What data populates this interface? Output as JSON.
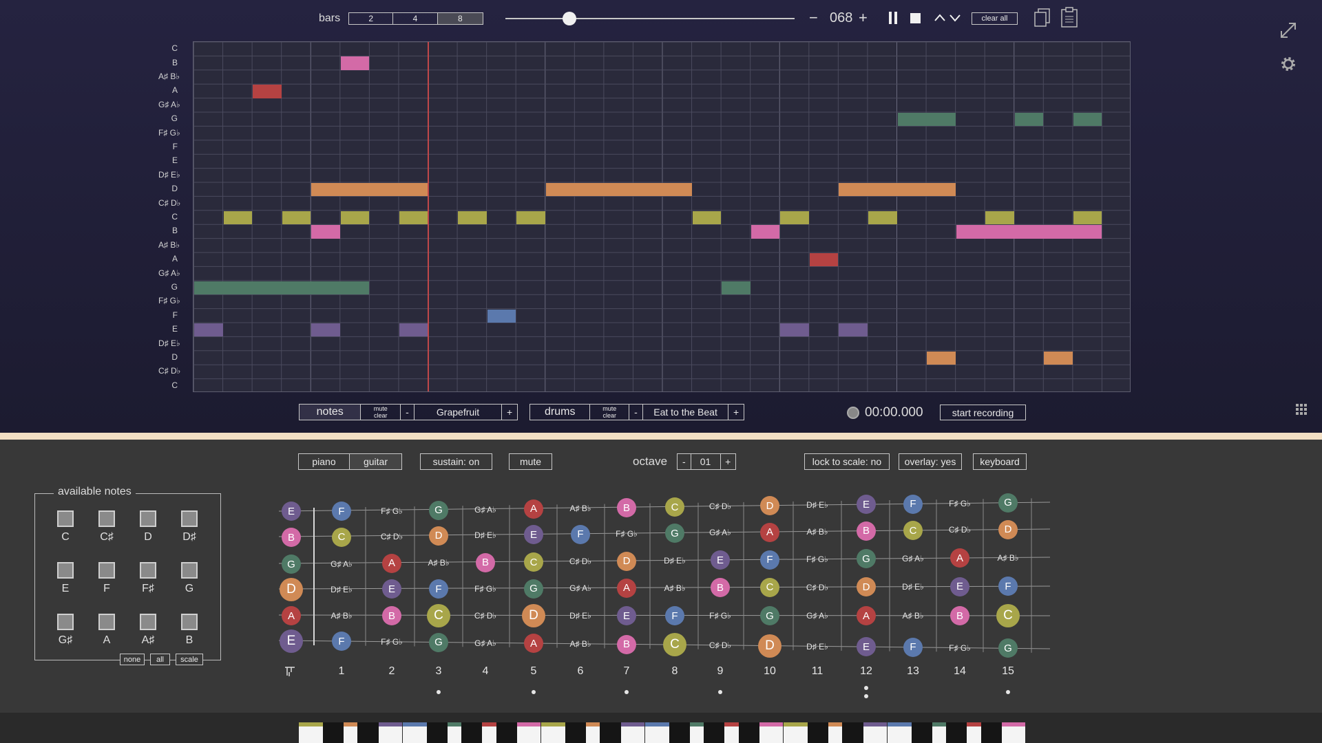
{
  "colors": {
    "C": "#a8a64a",
    "D": "#d08a55",
    "E": "#6f5c8f",
    "F": "#5b79ad",
    "G": "#4f7a66",
    "A": "#b54242",
    "B": "#d36aa7"
  },
  "toolbar": {
    "bars_label": "bars",
    "bars_options": [
      "2",
      "4",
      "8"
    ],
    "tempo": "068",
    "minus": "−",
    "plus": "+",
    "clear_all": "clear all"
  },
  "grid": {
    "row_labels": [
      "C",
      "B",
      "A♯ B♭",
      "A",
      "G♯ A♭",
      "G",
      "F♯ G♭",
      "F",
      "E",
      "D♯ E♭",
      "D",
      "C♯ D♭",
      "C",
      "B",
      "A♯ B♭",
      "A",
      "G♯ A♭",
      "G",
      "F♯ G♭",
      "F",
      "E",
      "D♯ E♭",
      "D",
      "C♯ D♭",
      "C"
    ],
    "columns": 32,
    "playhead_step": 8,
    "notes": [
      {
        "row": 1,
        "start": 5,
        "len": 1,
        "pitch": "B"
      },
      {
        "row": 3,
        "start": 2,
        "len": 1,
        "pitch": "A"
      },
      {
        "row": 5,
        "start": 24,
        "len": 2,
        "pitch": "G"
      },
      {
        "row": 5,
        "start": 28,
        "len": 1,
        "pitch": "G"
      },
      {
        "row": 5,
        "start": 30,
        "len": 1,
        "pitch": "G"
      },
      {
        "row": 10,
        "start": 4,
        "len": 4,
        "pitch": "D"
      },
      {
        "row": 10,
        "start": 12,
        "len": 5,
        "pitch": "D"
      },
      {
        "row": 10,
        "start": 22,
        "len": 4,
        "pitch": "D"
      },
      {
        "row": 12,
        "start": 1,
        "len": 1,
        "pitch": "C"
      },
      {
        "row": 12,
        "start": 3,
        "len": 1,
        "pitch": "C"
      },
      {
        "row": 12,
        "start": 5,
        "len": 1,
        "pitch": "C"
      },
      {
        "row": 12,
        "start": 7,
        "len": 1,
        "pitch": "C"
      },
      {
        "row": 12,
        "start": 9,
        "len": 1,
        "pitch": "C"
      },
      {
        "row": 12,
        "start": 11,
        "len": 1,
        "pitch": "C"
      },
      {
        "row": 12,
        "start": 17,
        "len": 1,
        "pitch": "C"
      },
      {
        "row": 12,
        "start": 20,
        "len": 1,
        "pitch": "C"
      },
      {
        "row": 12,
        "start": 23,
        "len": 1,
        "pitch": "C"
      },
      {
        "row": 12,
        "start": 27,
        "len": 1,
        "pitch": "C"
      },
      {
        "row": 12,
        "start": 30,
        "len": 1,
        "pitch": "C"
      },
      {
        "row": 13,
        "start": 4,
        "len": 1,
        "pitch": "B"
      },
      {
        "row": 13,
        "start": 19,
        "len": 1,
        "pitch": "B"
      },
      {
        "row": 13,
        "start": 26,
        "len": 5,
        "pitch": "B"
      },
      {
        "row": 15,
        "start": 21,
        "len": 1,
        "pitch": "A"
      },
      {
        "row": 17,
        "start": 0,
        "len": 6,
        "pitch": "G"
      },
      {
        "row": 17,
        "start": 18,
        "len": 1,
        "pitch": "G"
      },
      {
        "row": 19,
        "start": 10,
        "len": 1,
        "pitch": "F"
      },
      {
        "row": 20,
        "start": 0,
        "len": 1,
        "pitch": "E"
      },
      {
        "row": 20,
        "start": 4,
        "len": 1,
        "pitch": "E"
      },
      {
        "row": 20,
        "start": 7,
        "len": 1,
        "pitch": "E"
      },
      {
        "row": 20,
        "start": 20,
        "len": 1,
        "pitch": "E"
      },
      {
        "row": 20,
        "start": 22,
        "len": 1,
        "pitch": "E"
      },
      {
        "row": 22,
        "start": 25,
        "len": 1,
        "pitch": "D"
      },
      {
        "row": 22,
        "start": 29,
        "len": 1,
        "pitch": "D"
      }
    ]
  },
  "tracks": {
    "notes": {
      "label": "notes",
      "mute": "mute",
      "clear": "clear",
      "minus": "-",
      "name": "Grapefruit",
      "plus": "+"
    },
    "drums": {
      "label": "drums",
      "mute": "mute",
      "clear": "clear",
      "minus": "-",
      "name": "Eat to the Beat",
      "plus": "+"
    }
  },
  "recording": {
    "time": "00:00.000",
    "start": "start recording"
  },
  "controls": {
    "piano": "piano",
    "guitar": "guitar",
    "sustain": "sustain: on",
    "mute": "mute",
    "octave_label": "octave",
    "octave_minus": "-",
    "octave_value": "01",
    "octave_plus": "+",
    "lock": "lock to scale: no",
    "overlay": "overlay: yes",
    "keyboard": "keyboard"
  },
  "available": {
    "title": "available notes",
    "notes": [
      "C",
      "C♯",
      "D",
      "D♯",
      "E",
      "F",
      "F♯",
      "G",
      "G♯",
      "A",
      "A♯",
      "B"
    ],
    "none": "none",
    "all": "all",
    "scale": "scale"
  },
  "fretboard": {
    "open": [
      "E",
      "B",
      "G",
      "D",
      "A",
      "E"
    ],
    "frets": [
      [
        "F",
        "C",
        "G♯ A♭",
        "D♯ E♭",
        "A♯ B♭",
        "F"
      ],
      [
        "F♯ G♭",
        "C♯ D♭",
        "A",
        "E",
        "B",
        "F♯ G♭"
      ],
      [
        "G",
        "D",
        "A♯ B♭",
        "F",
        "C",
        "G"
      ],
      [
        "G♯ A♭",
        "D♯ E♭",
        "B",
        "F♯ G♭",
        "C♯ D♭",
        "G♯ A♭"
      ],
      [
        "A",
        "E",
        "C",
        "G",
        "D",
        "A"
      ],
      [
        "A♯ B♭",
        "F",
        "C♯ D♭",
        "G♯ A♭",
        "D♯ E♭",
        "A♯ B♭"
      ],
      [
        "B",
        "F♯ G♭",
        "D",
        "A",
        "E",
        "B"
      ],
      [
        "C",
        "G",
        "D♯ E♭",
        "A♯ B♭",
        "F",
        "C"
      ],
      [
        "C♯ D♭",
        "G♯ A♭",
        "E",
        "B",
        "F♯ G♭",
        "C♯ D♭"
      ],
      [
        "D",
        "A",
        "F",
        "C",
        "G",
        "D"
      ],
      [
        "D♯ E♭",
        "A♯ B♭",
        "F♯ G♭",
        "C♯ D♭",
        "G♯ A♭",
        "D♯ E♭"
      ],
      [
        "E",
        "B",
        "G",
        "D",
        "A",
        "E"
      ],
      [
        "F",
        "C",
        "G♯ A♭",
        "D♯ E♭",
        "A♯ B♭",
        "F"
      ],
      [
        "F♯ G♭",
        "C♯ D♭",
        "A",
        "E",
        "B",
        "F♯ G♭"
      ],
      [
        "G",
        "D",
        "A♯ B♭",
        "F",
        "C",
        "G"
      ]
    ],
    "fret_numbers": [
      "1",
      "2",
      "3",
      "4",
      "5",
      "6",
      "7",
      "8",
      "9",
      "10",
      "11",
      "12",
      "13",
      "14",
      "15"
    ],
    "single_inlays": [
      "3",
      "5",
      "7",
      "9",
      "15"
    ],
    "double_inlays": [
      "12"
    ]
  }
}
